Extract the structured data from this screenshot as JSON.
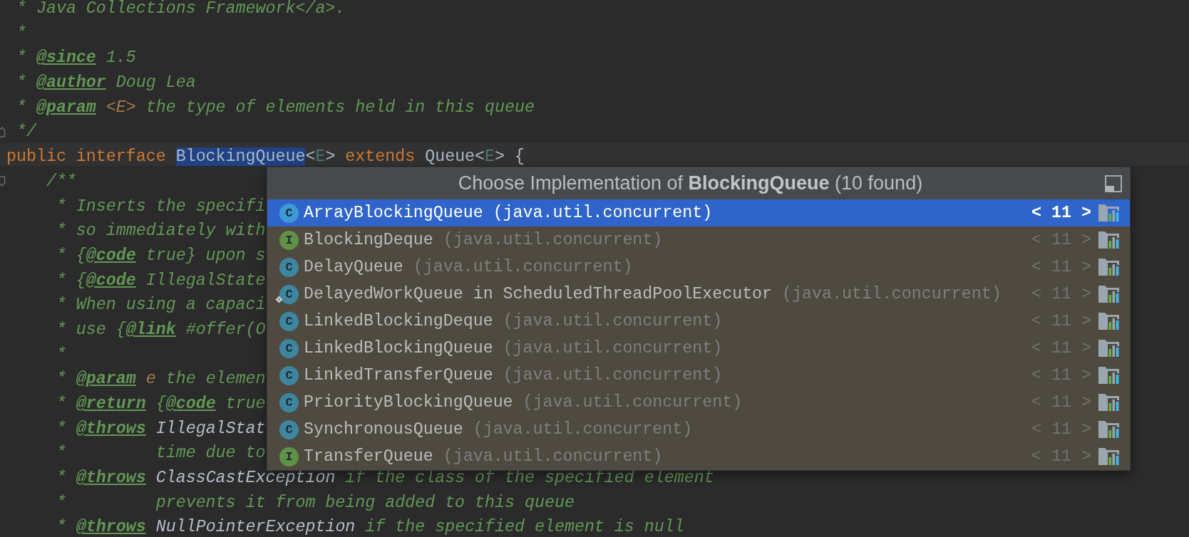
{
  "editor": {
    "lines": [
      {
        "tokens": [
          {
            "kind": "comment",
            "text": " * Java Collections Framework</a>."
          }
        ],
        "current": false
      },
      {
        "tokens": [
          {
            "kind": "comment",
            "text": " *"
          }
        ],
        "current": false
      },
      {
        "tokens": [
          {
            "kind": "comment",
            "text": " * "
          },
          {
            "kind": "tag",
            "text": "@since"
          },
          {
            "kind": "comment",
            "text": " 1.5"
          }
        ],
        "current": false
      },
      {
        "tokens": [
          {
            "kind": "comment",
            "text": " * "
          },
          {
            "kind": "tag",
            "text": "@author"
          },
          {
            "kind": "comment",
            "text": " Doug Lea"
          }
        ],
        "current": false
      },
      {
        "tokens": [
          {
            "kind": "comment",
            "text": " * "
          },
          {
            "kind": "tag",
            "text": "@param"
          },
          {
            "kind": "param",
            "text": " <E>"
          },
          {
            "kind": "comment",
            "text": " the type of elements held in this queue"
          }
        ],
        "current": false
      },
      {
        "tokens": [
          {
            "kind": "comment",
            "text": " */"
          }
        ],
        "current": false,
        "fold": {
          "kind": "end"
        }
      },
      {
        "tokens": [
          {
            "kind": "keyword",
            "text": "public interface "
          },
          {
            "kind": "selection",
            "text": "BlockingQueue"
          },
          {
            "kind": "plain",
            "text": "<"
          },
          {
            "kind": "typeparam",
            "text": "E"
          },
          {
            "kind": "plain",
            "text": "> "
          },
          {
            "kind": "keyword",
            "text": "extends "
          },
          {
            "kind": "plain",
            "text": "Queue<"
          },
          {
            "kind": "typeparam",
            "text": "E"
          },
          {
            "kind": "plain",
            "text": "> {"
          }
        ],
        "current": true
      },
      {
        "tokens": [
          {
            "kind": "comment",
            "text": "    /**"
          }
        ],
        "current": false,
        "fold": {
          "kind": "start"
        }
      },
      {
        "tokens": [
          {
            "kind": "comment",
            "text": "     * Inserts the specifi"
          }
        ],
        "current": false
      },
      {
        "tokens": [
          {
            "kind": "comment",
            "text": "     * so immediately with"
          }
        ],
        "current": false
      },
      {
        "tokens": [
          {
            "kind": "comment",
            "text": "     * {"
          },
          {
            "kind": "tag",
            "text": "@code"
          },
          {
            "kind": "comment",
            "text": " true} upon s"
          }
        ],
        "current": false
      },
      {
        "tokens": [
          {
            "kind": "comment",
            "text": "     * {"
          },
          {
            "kind": "tag",
            "text": "@code"
          },
          {
            "kind": "comment",
            "text": " IllegalState"
          }
        ],
        "current": false
      },
      {
        "tokens": [
          {
            "kind": "comment",
            "text": "     * When using a capaci"
          }
        ],
        "current": false
      },
      {
        "tokens": [
          {
            "kind": "comment",
            "text": "     * use {"
          },
          {
            "kind": "tag",
            "text": "@link"
          },
          {
            "kind": "comment",
            "text": " #offer(O"
          }
        ],
        "current": false
      },
      {
        "tokens": [
          {
            "kind": "comment",
            "text": "     *"
          }
        ],
        "current": false
      },
      {
        "tokens": [
          {
            "kind": "comment",
            "text": "     * "
          },
          {
            "kind": "tag",
            "text": "@param"
          },
          {
            "kind": "param",
            "text": " e"
          },
          {
            "kind": "comment",
            "text": " the elemen"
          }
        ],
        "current": false
      },
      {
        "tokens": [
          {
            "kind": "comment",
            "text": "     * "
          },
          {
            "kind": "tag",
            "text": "@return"
          },
          {
            "kind": "comment",
            "text": " {"
          },
          {
            "kind": "tag",
            "text": "@code"
          },
          {
            "kind": "comment",
            "text": " true"
          }
        ],
        "current": false
      },
      {
        "tokens": [
          {
            "kind": "comment",
            "text": "     * "
          },
          {
            "kind": "tag",
            "text": "@throws"
          },
          {
            "kind": "ref",
            "text": " IllegalStat"
          }
        ],
        "current": false
      },
      {
        "tokens": [
          {
            "kind": "comment",
            "text": "     *         time due to"
          }
        ],
        "current": false
      },
      {
        "tokens": [
          {
            "kind": "comment",
            "text": "     * "
          },
          {
            "kind": "tag",
            "text": "@throws"
          },
          {
            "kind": "ref",
            "text": " ClassCastException"
          },
          {
            "kind": "comment",
            "text": " if the class of the specified element"
          }
        ],
        "current": false
      },
      {
        "tokens": [
          {
            "kind": "comment",
            "text": "     *         prevents it from being added to this queue"
          }
        ],
        "current": false
      },
      {
        "tokens": [
          {
            "kind": "comment",
            "text": "     * "
          },
          {
            "kind": "tag",
            "text": "@throws"
          },
          {
            "kind": "ref",
            "text": " NullPointerException"
          },
          {
            "kind": "comment",
            "text": " if the specified element is null"
          }
        ],
        "current": false
      }
    ]
  },
  "popup": {
    "title": "Choose Implementation of **BlockingQueue** (10 found)",
    "rows": [
      {
        "kind": "class",
        "letter": "C",
        "name": "ArrayBlockingQueue",
        "location": "(java.util.concurrent)",
        "sdk": "< 11 >",
        "selected": true,
        "badge": false
      },
      {
        "kind": "interface",
        "letter": "I",
        "name": "BlockingDeque",
        "location": "(java.util.concurrent)",
        "sdk": "< 11 >",
        "selected": false,
        "badge": false
      },
      {
        "kind": "class",
        "letter": "C",
        "name": "DelayQueue",
        "location": "(java.util.concurrent)",
        "sdk": "< 11 >",
        "selected": false,
        "badge": false
      },
      {
        "kind": "class",
        "letter": "C",
        "name": "DelayedWorkQueue in ScheduledThreadPoolExecutor",
        "location": "(java.util.concurrent)",
        "sdk": "< 11 >",
        "selected": false,
        "badge": true
      },
      {
        "kind": "class",
        "letter": "C",
        "name": "LinkedBlockingDeque",
        "location": "(java.util.concurrent)",
        "sdk": "< 11 >",
        "selected": false,
        "badge": false
      },
      {
        "kind": "class",
        "letter": "C",
        "name": "LinkedBlockingQueue",
        "location": "(java.util.concurrent)",
        "sdk": "< 11 >",
        "selected": false,
        "badge": false
      },
      {
        "kind": "class",
        "letter": "C",
        "name": "LinkedTransferQueue",
        "location": "(java.util.concurrent)",
        "sdk": "< 11 >",
        "selected": false,
        "badge": false
      },
      {
        "kind": "class",
        "letter": "C",
        "name": "PriorityBlockingQueue",
        "location": "(java.util.concurrent)",
        "sdk": "< 11 >",
        "selected": false,
        "badge": false
      },
      {
        "kind": "class",
        "letter": "C",
        "name": "SynchronousQueue",
        "location": "(java.util.concurrent)",
        "sdk": "< 11 >",
        "selected": false,
        "badge": false
      },
      {
        "kind": "interface",
        "letter": "I",
        "name": "TransferQueue",
        "location": "(java.util.concurrent)",
        "sdk": "< 11 >",
        "selected": false,
        "badge": false
      }
    ]
  }
}
